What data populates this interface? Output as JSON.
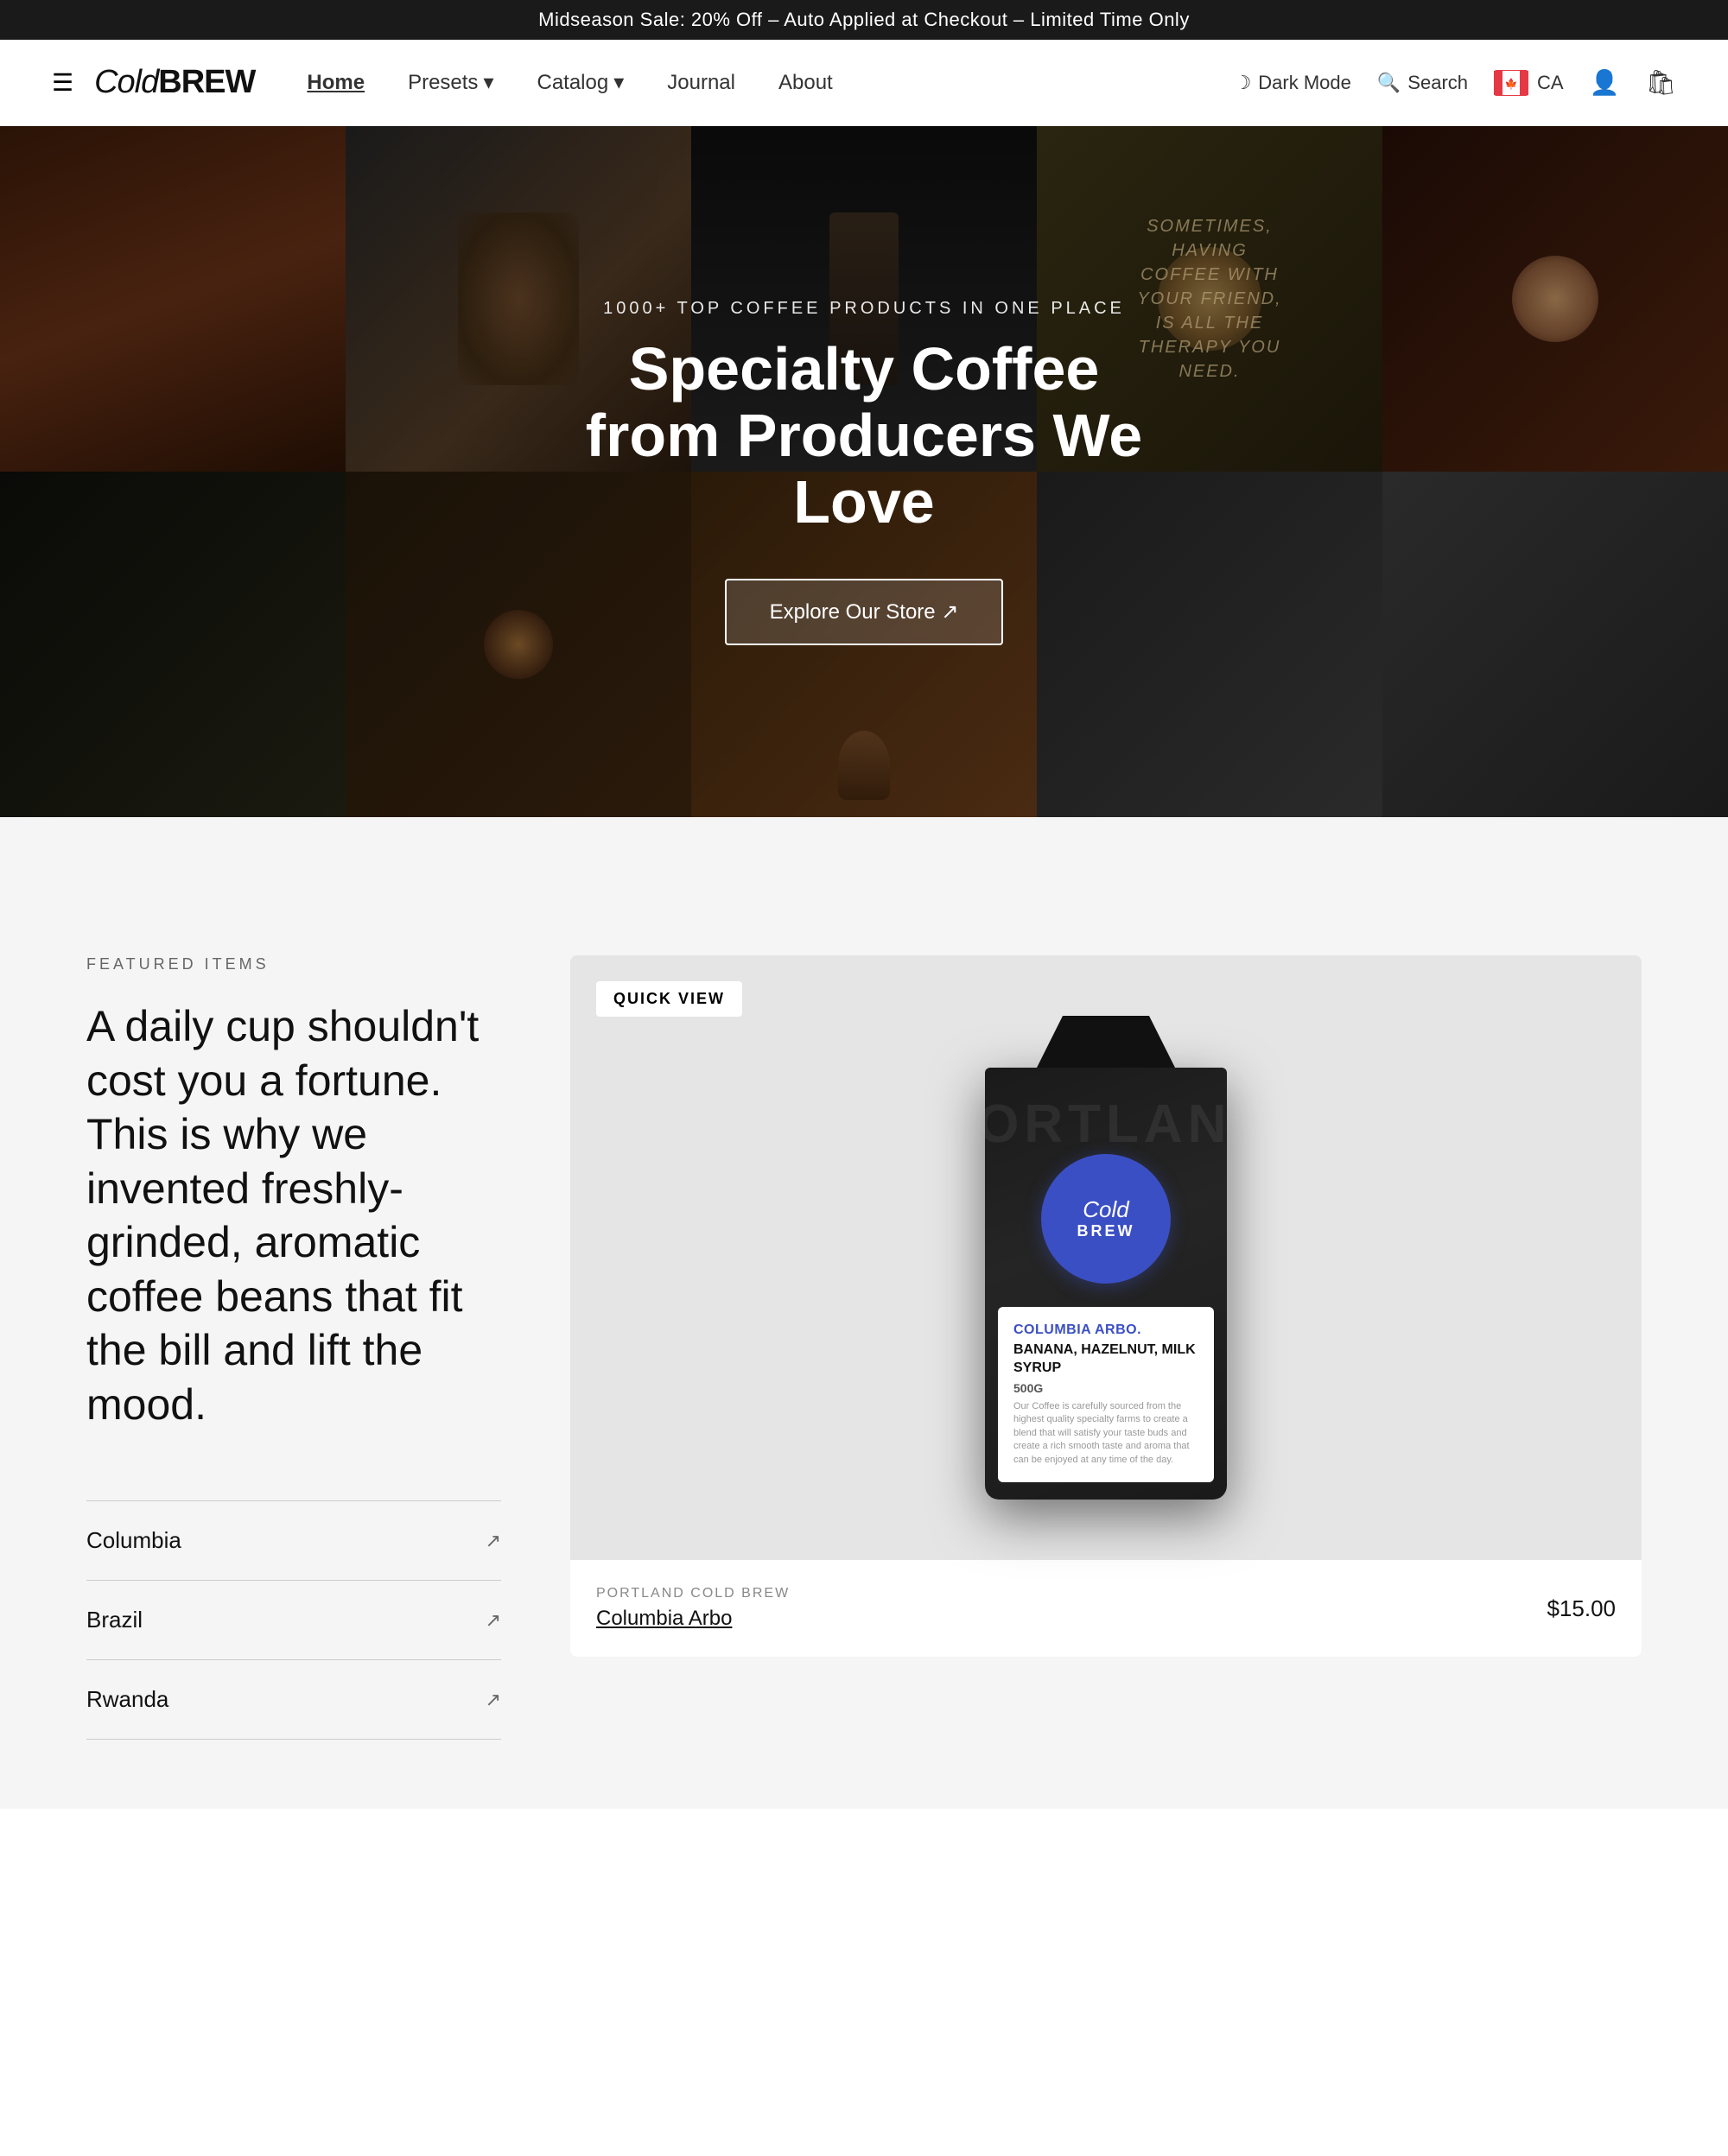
{
  "announcement": {
    "text": "Midseason Sale: 20% Off – Auto Applied at Checkout – Limited Time Only"
  },
  "header": {
    "logo": "Cold",
    "logo_bold": "BREW",
    "nav": [
      {
        "label": "Home",
        "active": true
      },
      {
        "label": "Presets",
        "has_dropdown": true
      },
      {
        "label": "Catalog",
        "has_dropdown": true
      },
      {
        "label": "Journal",
        "active": false
      },
      {
        "label": "About",
        "active": false
      }
    ],
    "dark_mode_label": "Dark Mode",
    "search_label": "Search",
    "country_code": "CA",
    "icons": {
      "hamburger": "☰",
      "moon": "☽",
      "search": "⌕",
      "user": "👤",
      "cart": "🛍"
    }
  },
  "hero": {
    "subtitle": "1000+ Top Coffee Products in One Place",
    "title": "Specialty Coffee from Producers We Love",
    "cta_label": "Explore Our Store ↗",
    "quote": "Sometimes, having coffee with your friend, is all the therapy you need."
  },
  "featured": {
    "label": "Featured Items",
    "heading": "A daily cup shouldn't cost you a fortune. This is why we invented freshly-grinded, aromatic coffee beans that fit the bill and lift the mood.",
    "items": [
      {
        "name": "Columbia"
      },
      {
        "name": "Brazil"
      },
      {
        "name": "Rwanda"
      }
    ]
  },
  "product": {
    "quick_view_label": "Quick View",
    "brand_name": "PORTLAND COLD BREW",
    "product_name": "Columbia Arbo",
    "price": "$15.00",
    "bag_text": "PORTLAND",
    "logo_text": "Cold",
    "logo_brew": "BREW",
    "label_title": "Columbia Arbo.",
    "label_desc": "Banana, Hazelnut, Milk Syrup",
    "label_weight": "500G",
    "label_body": "Our Coffee is carefully sourced from the highest quality specialty farms to create a blend that will satisfy your taste buds and create a rich smooth taste and aroma that can be enjoyed at any time of the day."
  }
}
